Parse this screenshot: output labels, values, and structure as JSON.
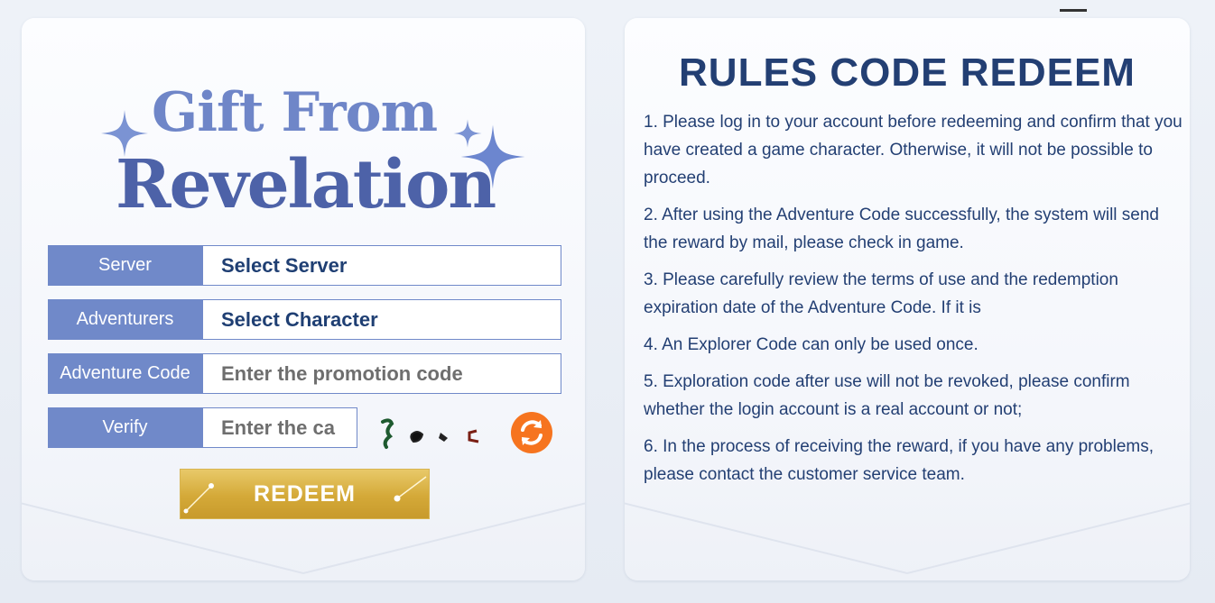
{
  "logo": {
    "line1": "Gift From",
    "line2": "Revelation"
  },
  "form": {
    "server_label": "Server",
    "server_value": "Select Server",
    "adventurers_label": "Adventurers",
    "adventurers_value": "Select Character",
    "code_label": "Adventure Code",
    "code_placeholder": "Enter the promotion code",
    "verify_label": "Verify",
    "verify_placeholder": "Enter the ca",
    "refresh_icon": "refresh-icon",
    "redeem_label": "REDEEM"
  },
  "rules": {
    "title": "RULES CODE REDEEM",
    "items": [
      "1. Please log in to your account before redeeming and confirm that you have created a game character. Otherwise, it will not be possible to proceed.",
      "2. After using the Adventure Code successfully, the system will send the reward by mail, please check in game.",
      "3. Please carefully review the terms of use and the redemption expiration date of the Adventure Code. If it is",
      "4. An Explorer Code can only be used once.",
      "5. Exploration code after use will not be revoked, please confirm whether the login account is a real account or not;",
      "6. In the process of receiving the reward, if you have any problems, please contact the customer service team."
    ]
  },
  "colors": {
    "label_bg": "#7089c9",
    "title_text": "#233f73",
    "redeem_gold": "#d4a938",
    "refresh_orange": "#f6741f"
  }
}
